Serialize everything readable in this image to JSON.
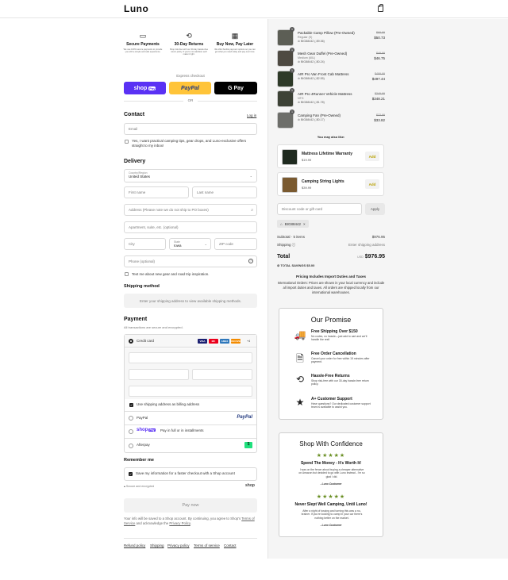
{
  "header": {
    "logo": "Luno",
    "cart_icon": "shopping-bag-icon"
  },
  "features": [
    {
      "icon": "card-icon",
      "title": "Secure Payments",
      "desc": "We use 100% secure payments to provide you with a simple and safe experience."
    },
    {
      "icon": "return-icon",
      "title": "30-Day Returns",
      "desc": "Shop risk-free with our 30-day hassle-free return policy. If you're not satisfied, we'll make it right."
    },
    {
      "icon": "calendar-icon",
      "title": "Buy Now, Pay Later",
      "desc": "We offer flexible payment options so you can get what you need today and pay over time."
    }
  ],
  "express": {
    "label": "Express checkout",
    "shop_pay": "shop",
    "shop_pay_badge": "Pay",
    "paypal": "PayPal",
    "gpay": "G Pay",
    "or": "OR"
  },
  "contact": {
    "title": "Contact",
    "login": "Log in",
    "email_placeholder": "Email",
    "newsletter": "Yes, I want practical camping tips, gear drops, and Luno-exclusive offers straight to my inbox!"
  },
  "delivery": {
    "title": "Delivery",
    "country_label": "Country/Region",
    "country": "United States",
    "first_name": "First name",
    "last_name": "Last name",
    "address": "Address (Please note we do not ship to PO boxes)",
    "apartment": "Apartment, suite, etc. (optional)",
    "city": "City",
    "state_label": "State",
    "state": "Iowa",
    "zip": "ZIP code",
    "phone": "Phone (optional)",
    "text_me": "Text me about new gear and road trip inspiration."
  },
  "shipping": {
    "title": "Shipping method",
    "notice": "Enter your shipping address to view available shipping methods."
  },
  "payment": {
    "title": "Payment",
    "subtitle": "All transactions are secure and encrypted.",
    "credit_card": "Credit card",
    "cards": [
      {
        "name": "VISA",
        "color": "#1a1f71"
      },
      {
        "name": "MC",
        "color": "#eb001b"
      },
      {
        "name": "AMEX",
        "color": "#2e77bb"
      },
      {
        "name": "DISCOVER",
        "color": "#f38b00"
      }
    ],
    "more_cards": "+4",
    "billing_same": "Use shipping address as billing address",
    "paypal": "PayPal",
    "paypal_logo": "PayPal",
    "shoppay_logo": "shop",
    "shoppay_badge": "Pay",
    "shoppay_text": "Pay in full or in installments",
    "afterpay": "Afterpay",
    "afterpay_logo": "$"
  },
  "remember": {
    "title": "Remember me",
    "save": "Save my information for a faster checkout with a Shop account",
    "secure": "Secure and encrypted",
    "shop": "shop"
  },
  "pay_now": "Pay now",
  "legal": {
    "pre": "Your info will be saved to a Shop account. By continuing, you agree to Shop's ",
    "terms": "Terms of Service",
    "mid": " and acknowledge the ",
    "privacy": "Privacy Policy",
    "post": "."
  },
  "footer": [
    "Refund policy",
    "Shipping",
    "Privacy policy",
    "Terms of service",
    "Contact"
  ],
  "cart": [
    {
      "qty": "1",
      "name": "Packable Camp Pillow (Pre-Owned)",
      "variant": "Regular (S)",
      "discount": "BIG88442 (-$9.36)",
      "old": "$69.99",
      "new": "$50.73",
      "color": "#5c5e55"
    },
    {
      "qty": "1",
      "name": "Mesh Gear Duffel (Pre-Owned)",
      "variant": "Medium (60L)",
      "discount": "BIG88442 (-$0.24)",
      "old": "$49.99",
      "new": "$46.75",
      "color": "#4e4a42"
    },
    {
      "qty": "1",
      "name": "AIR Pro Van Front Cab Mattress",
      "variant": "",
      "discount": "BIG88442 (-$2.55)",
      "old": "$499.99",
      "new": "$497.44",
      "color": "#2e3a28"
    },
    {
      "qty": "1",
      "name": "AIR Pro 4Runner Vehicle Mattress",
      "variant": "NTG",
      "discount": "BIG88442 (-$1.78)",
      "old": "$349.99",
      "new": "$348.21",
      "color": "#3d4236"
    },
    {
      "qty": "1",
      "name": "Camping Fan (Pre-Owned)",
      "variant": "",
      "discount": "BIG88442 (-$0.17)",
      "old": "$33.99",
      "new": "$33.82",
      "color": "#6d6e6a"
    }
  ],
  "upsell": {
    "title": "You may also like:",
    "items": [
      {
        "name": "Mattress Lifetime Warranty",
        "price": "$19.99",
        "add": "Add",
        "color": "#1f2a1f"
      },
      {
        "name": "Camping String Lights",
        "price": "$39.99",
        "add": "Add",
        "color": "#7a5a30"
      }
    ]
  },
  "discount": {
    "placeholder": "Discount code or gift card",
    "apply": "Apply",
    "code": "BIG88442"
  },
  "summary": {
    "subtotal_label": "Subtotal · 5 items",
    "subtotal": "$976.95",
    "shipping_label": "Shipping",
    "shipping": "Enter shipping address",
    "total_label": "Total",
    "currency": "USD",
    "total": "$976.95",
    "savings": "TOTAL SAVINGS  $5.00"
  },
  "duties": {
    "title": "Pricing Includes Import Duties and Taxes",
    "body": "International Orders: Prices are shown in your local currency and include all import duties and taxes. All orders are shipped locally from our international warehouses."
  },
  "promise": {
    "title": "Our Promise",
    "items": [
      {
        "icon": "truck-icon",
        "glyph": "🚚",
        "title": "Free Shipping Over $150",
        "desc": "No codes, no hassle—just add to cart and we'll handle the rest!"
      },
      {
        "icon": "cancel-doc-icon",
        "glyph": "🗎",
        "title": "Free Order Cancellation",
        "desc": "Cancel your order for free within 15 minutes after payment."
      },
      {
        "icon": "return-box-icon",
        "glyph": "⟲",
        "title": "Hassle-Free Returns",
        "desc": "Shop risk-free with our 30-day hassle-free return policy."
      },
      {
        "icon": "stars-icon",
        "glyph": "★",
        "title": "A+ Customer Support",
        "desc": "Have questions? Our dedicated customer support team is available to assist you."
      }
    ]
  },
  "confidence": {
    "title": "Shop With Confidence",
    "reviews": [
      {
        "stars": "★★★★★",
        "title": "Spend The Money - It's Worth It!",
        "body": "I was on the fence about buying a cheaper alternative on Amazon but decided to go with Luno instead - I'm so glad I did.",
        "author": "- Luno Customer"
      },
      {
        "stars": "★★★★★",
        "title": "Never Slept Well Camping, Until Luno!",
        "body": "After a night of tossing and turning this was a no-brainer. If you're looking to camp in your car there's nothing better on the market.",
        "author": "- Luno Customer"
      }
    ]
  }
}
